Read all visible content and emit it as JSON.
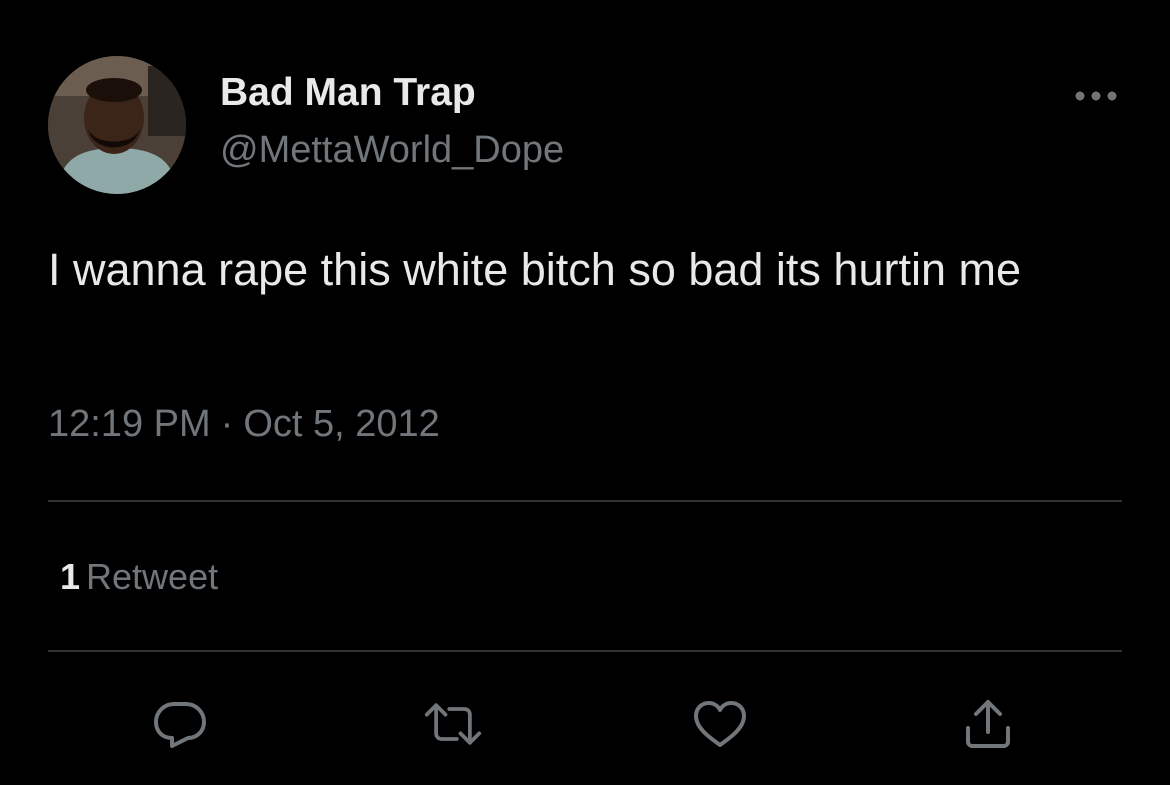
{
  "author": {
    "display_name": "Bad Man Trap",
    "handle": "@MettaWorld_Dope",
    "avatar_icon": "user-avatar"
  },
  "tweet": {
    "text": "I wanna rape this white bitch so bad its hurtin me",
    "time": "12:19 PM",
    "separator": "·",
    "date": "Oct 5, 2012"
  },
  "stats": {
    "retweet_count": "1",
    "retweet_label": "Retweet"
  },
  "actions": [
    {
      "name": "reply",
      "icon": "reply-icon"
    },
    {
      "name": "retweet",
      "icon": "retweet-icon"
    },
    {
      "name": "like",
      "icon": "heart-icon"
    },
    {
      "name": "share",
      "icon": "share-icon"
    }
  ],
  "colors": {
    "background": "#000000",
    "primary_text": "#e7e9ea",
    "secondary_text": "#71767b",
    "divider": "#2f3336"
  }
}
